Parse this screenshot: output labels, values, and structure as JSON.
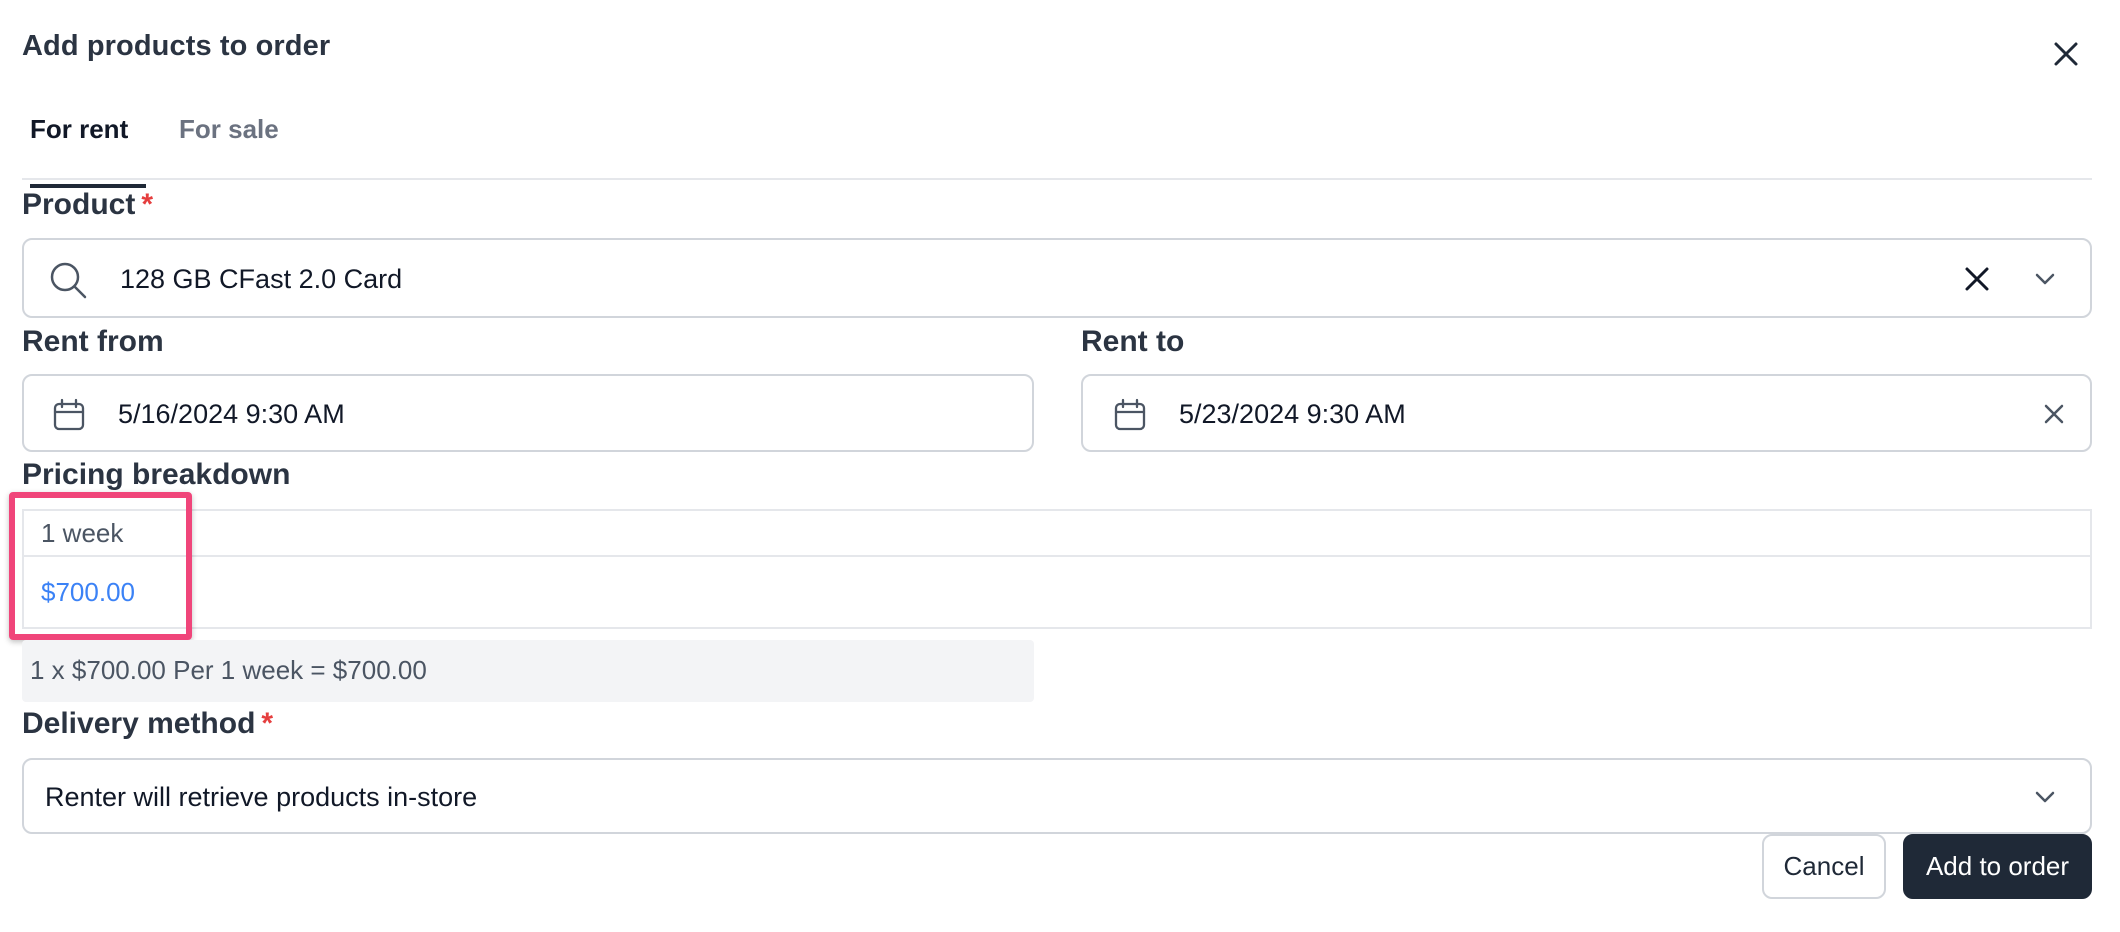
{
  "dialog": {
    "title": "Add products to order",
    "close_icon": "close-icon"
  },
  "tabs": [
    {
      "label": "For rent",
      "active": true
    },
    {
      "label": "For sale",
      "active": false
    }
  ],
  "product": {
    "label": "Product",
    "required_mark": "*",
    "value": "128 GB CFast 2.0 Card",
    "icons": [
      "search-icon",
      "clear-icon",
      "chevron-down-icon"
    ]
  },
  "rent_from": {
    "label": "Rent from",
    "value": "5/16/2024 9:30 AM",
    "icon": "calendar-icon"
  },
  "rent_to": {
    "label": "Rent to",
    "value": "5/23/2024 9:30 AM",
    "icons": [
      "calendar-icon",
      "clear-icon"
    ]
  },
  "pricing": {
    "label": "Pricing breakdown",
    "period": "1 week",
    "price": "$700.00",
    "summary": "1 x $700.00 Per 1 week = $700.00"
  },
  "delivery": {
    "label": "Delivery method",
    "required_mark": "*",
    "value": "Renter will retrieve products in-store",
    "icon": "chevron-down-icon"
  },
  "buttons": {
    "cancel": "Cancel",
    "add": "Add to order"
  },
  "colors": {
    "primary": "#1f2937",
    "required": "#e53e3e",
    "price_link": "#3b82f6",
    "highlight": "#f0457a"
  }
}
